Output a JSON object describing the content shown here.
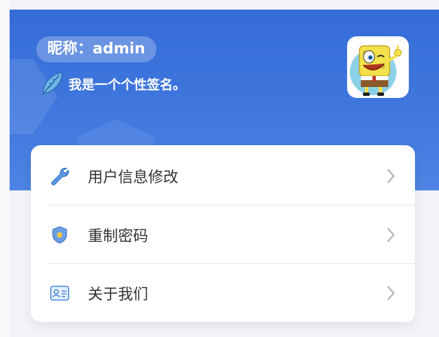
{
  "profile": {
    "nickname_text": "昵称：admin",
    "signature_text": "我是一个个性签名。"
  },
  "menu": {
    "items": [
      {
        "label": "用户信息修改",
        "icon": "wrench-icon"
      },
      {
        "label": "重制密码",
        "icon": "shield-icon"
      },
      {
        "label": "关于我们",
        "icon": "id-card-icon"
      }
    ]
  },
  "colors": {
    "header_top": "#356cd8",
    "header_bottom": "#4e84e3",
    "background": "#f3f4f7",
    "card": "#ffffff",
    "chevron": "#b5b5b5"
  }
}
